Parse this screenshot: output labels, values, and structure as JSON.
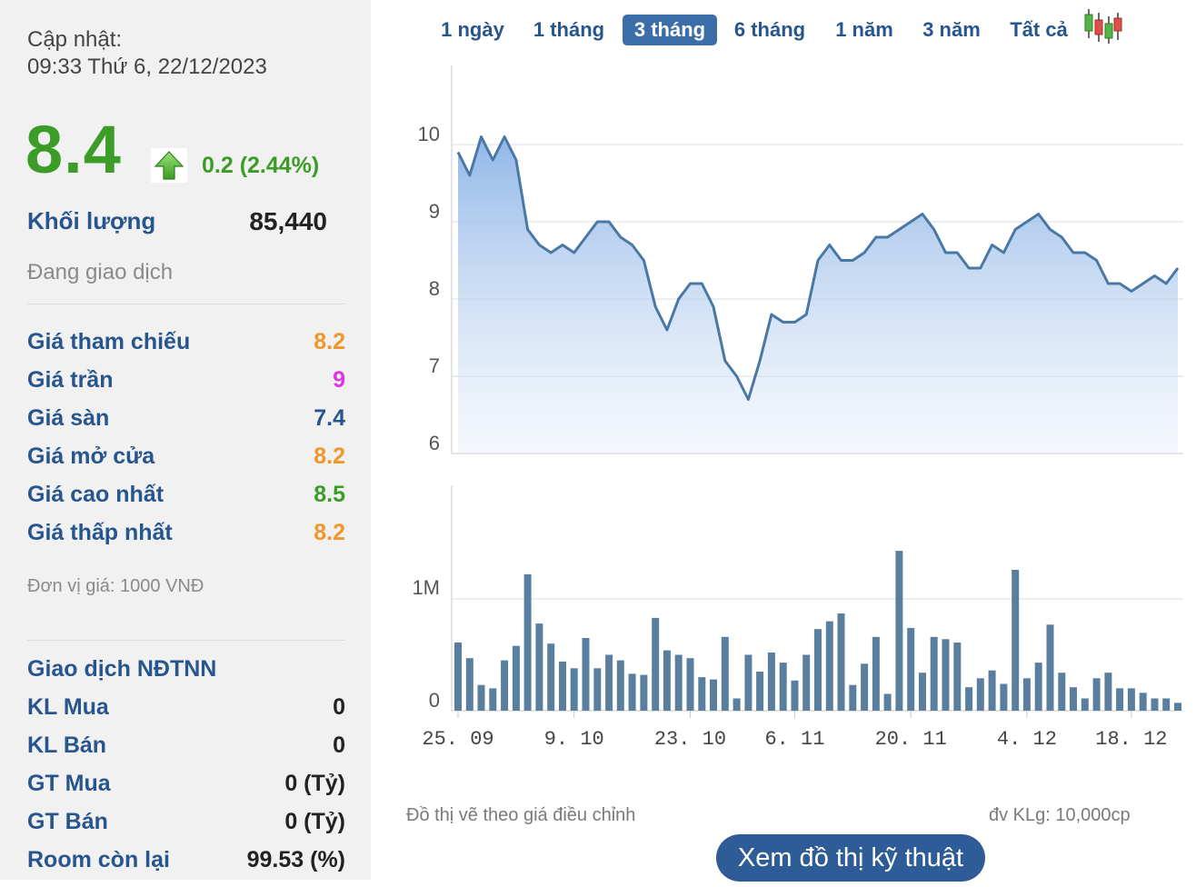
{
  "summary": {
    "update_label": "Cập nhật:",
    "update_time": "09:33 Thứ 6, 22/12/2023",
    "price": "8.4",
    "change": "0.2 (2.44%)",
    "volume_label": "Khối lượng",
    "volume": "85,440",
    "status": "Đang giao dịch",
    "unit_note": "Đơn vị giá: 1000 VNĐ"
  },
  "stats": [
    {
      "label": "Giá tham chiếu",
      "value": "8.2",
      "color": "#f0962a"
    },
    {
      "label": "Giá trần",
      "value": "9",
      "color": "#e133e6"
    },
    {
      "label": "Giá sàn",
      "value": "7.4",
      "color": "#27558e"
    },
    {
      "label": "Giá mở cửa",
      "value": "8.2",
      "color": "#f0962a"
    },
    {
      "label": "Giá cao nhất",
      "value": "8.5",
      "color": "#3c9c28"
    },
    {
      "label": "Giá thấp nhất",
      "value": "8.2",
      "color": "#f0962a"
    }
  ],
  "foreign": {
    "title": "Giao dịch NĐTNN",
    "rows": [
      {
        "label": "KL Mua",
        "value": "0"
      },
      {
        "label": "KL Bán",
        "value": "0"
      },
      {
        "label": "GT Mua",
        "value": "0 (Tỷ)"
      },
      {
        "label": "GT Bán",
        "value": "0 (Tỷ)"
      },
      {
        "label": "Room còn lại",
        "value": "99.53 (%)"
      }
    ]
  },
  "ranges": [
    "1 ngày",
    "1 tháng",
    "3 tháng",
    "6 tháng",
    "1 năm",
    "3 năm",
    "Tất cả"
  ],
  "active_range": "3 tháng",
  "candlestick_icon": "candlestick-icon",
  "footer": {
    "note_left": "Đồ thị vẽ theo giá điều chỉnh",
    "note_right": "đv KLg: 10,000cp",
    "tech_button": "Xem đồ thị kỹ thuật"
  },
  "colors": {
    "line": "#4a78a6",
    "volume_bar": "#5a7f9e",
    "up": "#3c9c28",
    "label": "#27558e"
  },
  "chart_data": {
    "type": "area",
    "price_axis": {
      "ticks": [
        "10",
        "9",
        "8",
        "7",
        "6"
      ],
      "ylim": [
        6,
        10.4
      ]
    },
    "volume_axis": {
      "ticks": [
        "1M",
        "0"
      ],
      "max_label_value": 1000000
    },
    "x_ticks": [
      "25. 09",
      "9. 10",
      "23. 10",
      "6. 11",
      "20. 11",
      "4. 12",
      "18. 12"
    ],
    "x_tick_index": [
      0,
      10,
      20,
      29,
      39,
      49,
      58
    ],
    "price": [
      9.9,
      9.6,
      10.1,
      9.8,
      10.1,
      9.8,
      8.9,
      8.7,
      8.6,
      8.7,
      8.6,
      8.8,
      9.0,
      9.0,
      8.8,
      8.7,
      8.5,
      7.9,
      7.6,
      8.0,
      8.2,
      8.2,
      7.9,
      7.2,
      7.0,
      6.7,
      7.2,
      7.8,
      7.7,
      7.7,
      7.8,
      8.5,
      8.7,
      8.5,
      8.5,
      8.6,
      8.8,
      8.8,
      8.9,
      9.0,
      9.1,
      8.9,
      8.6,
      8.6,
      8.4,
      8.4,
      8.7,
      8.6,
      8.9,
      9.0,
      9.1,
      8.9,
      8.8,
      8.6,
      8.6,
      8.5,
      8.2,
      8.2,
      8.1,
      8.2,
      8.3,
      8.2,
      8.4
    ],
    "volume": [
      610000,
      470000,
      230000,
      200000,
      450000,
      580000,
      1220000,
      780000,
      600000,
      440000,
      380000,
      650000,
      380000,
      500000,
      450000,
      330000,
      320000,
      830000,
      540000,
      500000,
      470000,
      300000,
      280000,
      660000,
      110000,
      500000,
      350000,
      520000,
      430000,
      270000,
      500000,
      730000,
      800000,
      870000,
      230000,
      420000,
      660000,
      150000,
      1430000,
      740000,
      340000,
      660000,
      640000,
      610000,
      210000,
      290000,
      360000,
      240000,
      1260000,
      290000,
      430000,
      770000,
      340000,
      210000,
      110000,
      290000,
      340000,
      200000,
      200000,
      160000,
      110000,
      110000,
      70000
    ]
  }
}
